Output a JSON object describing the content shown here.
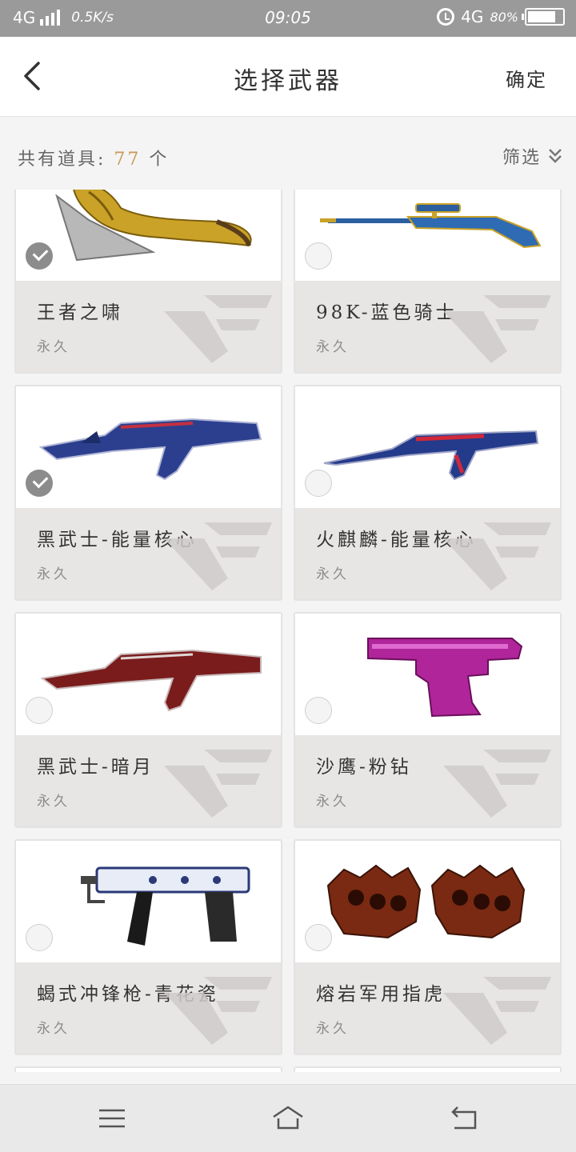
{
  "status_bar": {
    "network": "4G",
    "speed": "0.5K/s",
    "time": "09:05",
    "network_right": "4G",
    "battery_pct": "80%",
    "battery_level": 0.8
  },
  "header": {
    "title": "选择武器",
    "confirm_label": "确定"
  },
  "summary": {
    "prefix": "共有道具:",
    "count": "77",
    "suffix": "个",
    "filter_label": "筛选"
  },
  "items": [
    {
      "name": "王者之啸",
      "duration": "永久",
      "selected": true
    },
    {
      "name": "98K-蓝色骑士",
      "duration": "永久",
      "selected": false
    },
    {
      "name": "黑武士-能量核心",
      "duration": "永久",
      "selected": true
    },
    {
      "name": "火麒麟-能量核心",
      "duration": "永久",
      "selected": false
    },
    {
      "name": "黑武士-暗月",
      "duration": "永久",
      "selected": false
    },
    {
      "name": "沙鹰-粉钻",
      "duration": "永久",
      "selected": false
    },
    {
      "name": "蝎式冲锋枪-青花瓷",
      "duration": "永久",
      "selected": false
    },
    {
      "name": "熔岩军用指虎",
      "duration": "永久",
      "selected": false
    }
  ],
  "colors": {
    "accent": "#c89a56",
    "status_bar_bg": "#9a9a9a",
    "card_info_bg": "#e8e6e4",
    "check_on": "#8c8c8c"
  }
}
